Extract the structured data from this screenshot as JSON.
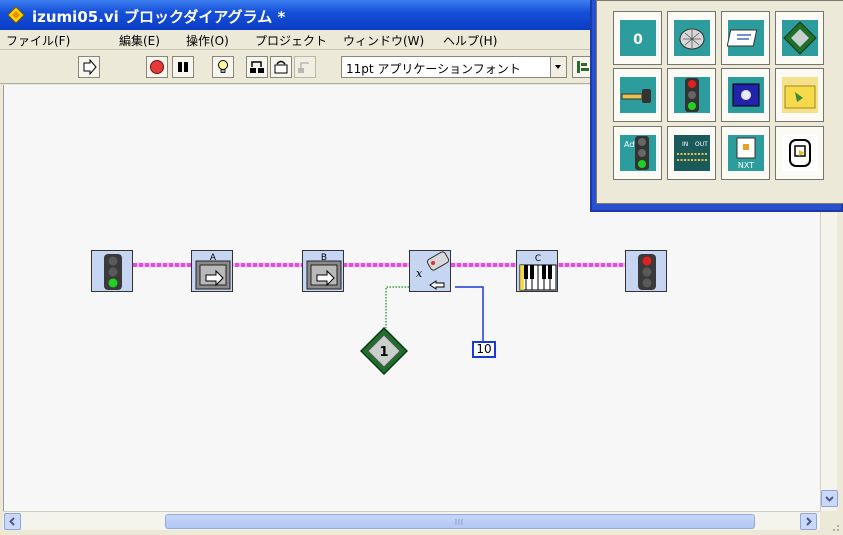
{
  "window": {
    "title": "izumi05.vi ブロックダイアグラム *"
  },
  "menu": [
    "ファイル(F)",
    "編集(E)",
    "操作(O)",
    "プロジェクト",
    "ウィンドウ(W)",
    "ヘルプ(H)"
  ],
  "toolbar": {
    "font": "11pt アプリケーションフォント"
  },
  "diagram": {
    "nodes": [
      {
        "name": "begin-traffic-light-green",
        "icon": "traffic-light-green-icon"
      },
      {
        "name": "motor-a-block",
        "icon": "motor-a-icon",
        "label": "A"
      },
      {
        "name": "motor-b-block",
        "icon": "motor-b-icon",
        "label": "B"
      },
      {
        "name": "wait-block",
        "icon": "wait-icon"
      },
      {
        "name": "sound-c-block",
        "icon": "piano-keys-icon",
        "label": "C"
      },
      {
        "name": "end-traffic-light-red",
        "icon": "traffic-light-red-icon"
      }
    ],
    "constant_value": "10",
    "diamond_label": "1"
  },
  "palette": {
    "labels": [
      "0",
      "Adv",
      "NXT",
      "IN",
      "OUT"
    ]
  },
  "colors": {
    "title_bar": "#1650d8",
    "wire_pink": "#e94ae0",
    "wire_blue": "#1a3ad6",
    "wire_green": "#3aa03a",
    "palette_frame": "#2a4fcf"
  }
}
